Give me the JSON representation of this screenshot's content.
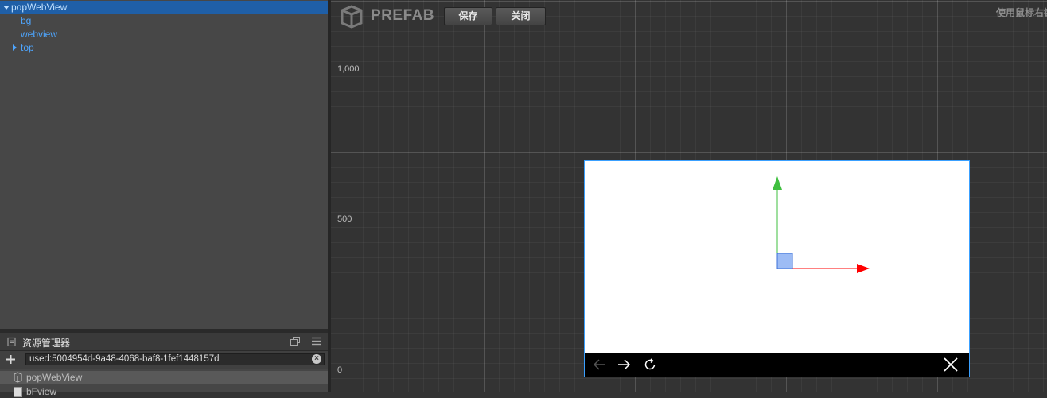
{
  "hierarchy": {
    "nodes": [
      {
        "label": "popWebView",
        "expanded": true,
        "selected": true,
        "icon": "triangle-down-icon"
      },
      {
        "label": "bg"
      },
      {
        "label": "webview"
      },
      {
        "label": "top",
        "expanded": false,
        "icon": "triangle-right-icon"
      }
    ]
  },
  "assets": {
    "title": "资源管理器",
    "search_value": "used:5004954d-9a48-4068-baf8-1fef1448157d",
    "rows": [
      {
        "label": "popWebView",
        "icon": "prefab-icon"
      },
      {
        "label": "bFview",
        "icon": "file-icon"
      }
    ]
  },
  "toolbar": {
    "prefab_title": "PREFAB",
    "save_label": "保存",
    "close_label": "关闭",
    "hint": "使用鼠标右键"
  },
  "scene": {
    "axis_labels": [
      "1,000",
      "500",
      "0"
    ],
    "colors": {
      "x_axis": "#ff0000",
      "y_axis": "#3fbf3f",
      "selection": "#3aa0ff"
    }
  }
}
